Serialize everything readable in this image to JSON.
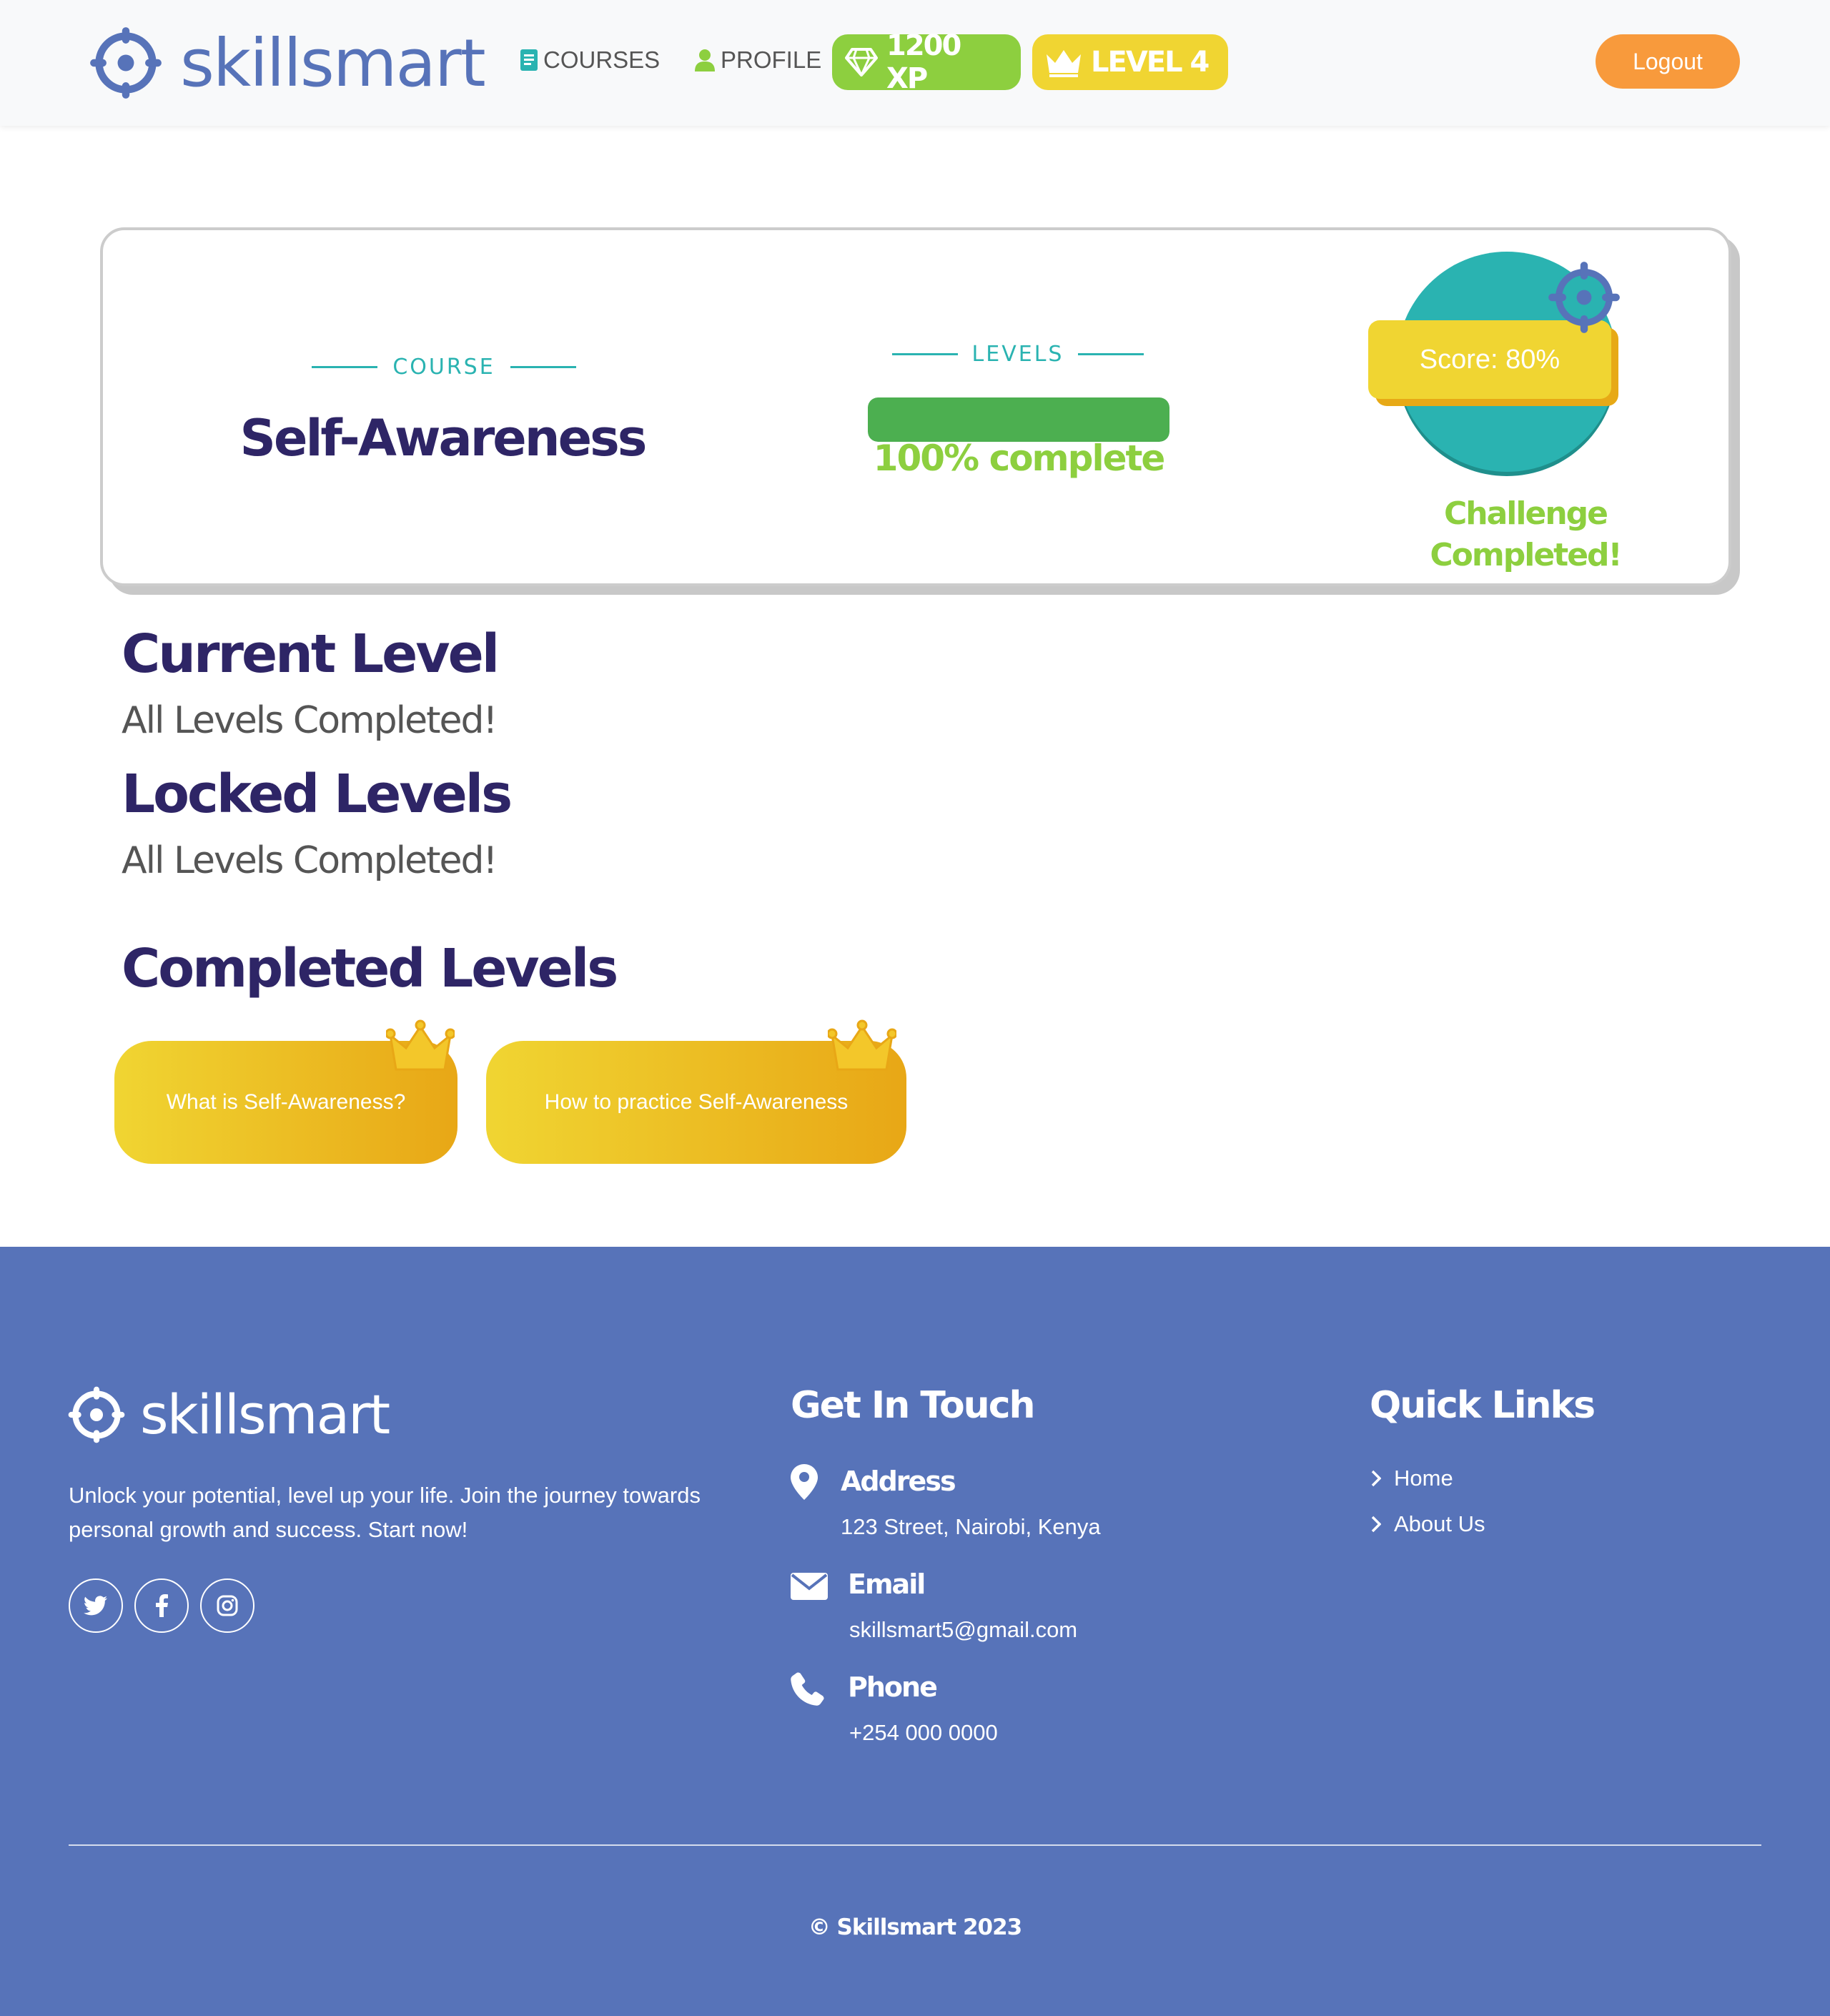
{
  "nav": {
    "brand": "skillsmart",
    "links": [
      {
        "label": "COURSES",
        "icon": "book-icon"
      },
      {
        "label": "PROFILE",
        "icon": "user-icon"
      }
    ],
    "xp": "1200 XP",
    "level": "LEVEL 4",
    "logout": "Logout"
  },
  "course": {
    "section_label": "COURSE",
    "title": "Self-Awareness",
    "levels_label": "LEVELS",
    "progress_percent": 100,
    "progress_text": "100% complete",
    "score": "Score: 80%",
    "challenge_line1": "Challenge",
    "challenge_line2": "Completed!"
  },
  "sections": {
    "current_title": "Current Level",
    "current_status": "All Levels Completed!",
    "locked_title": "Locked Levels",
    "locked_status": "All Levels Completed!",
    "completed_title": "Completed Levels",
    "completed_levels": [
      "What is Self-Awareness?",
      "How to practice Self-Awareness"
    ]
  },
  "footer": {
    "brand": "skillsmart",
    "tagline": "Unlock your potential, level up your life. Join the journey towards personal growth and success. Start now!",
    "social": [
      "twitter-icon",
      "facebook-icon",
      "instagram-icon"
    ],
    "contact_heading": "Get In Touch",
    "address_label": "Address",
    "address_value": "123 Street, Nairobi, Kenya",
    "email_label": "Email",
    "email_value": "skillsmart5@gmail.com",
    "phone_label": "Phone",
    "phone_value": "+254 000 0000",
    "links_heading": "Quick Links",
    "links": [
      "Home",
      "About Us"
    ],
    "copyright": "© Skillsmart 2023"
  },
  "colors": {
    "brand_blue": "#5773b9",
    "navy": "#2e2566",
    "teal": "#2ab3b1",
    "green": "#8dcf3f",
    "progress_green": "#4caf50",
    "yellow": "#f0d532",
    "orange": "#f89a3c"
  }
}
